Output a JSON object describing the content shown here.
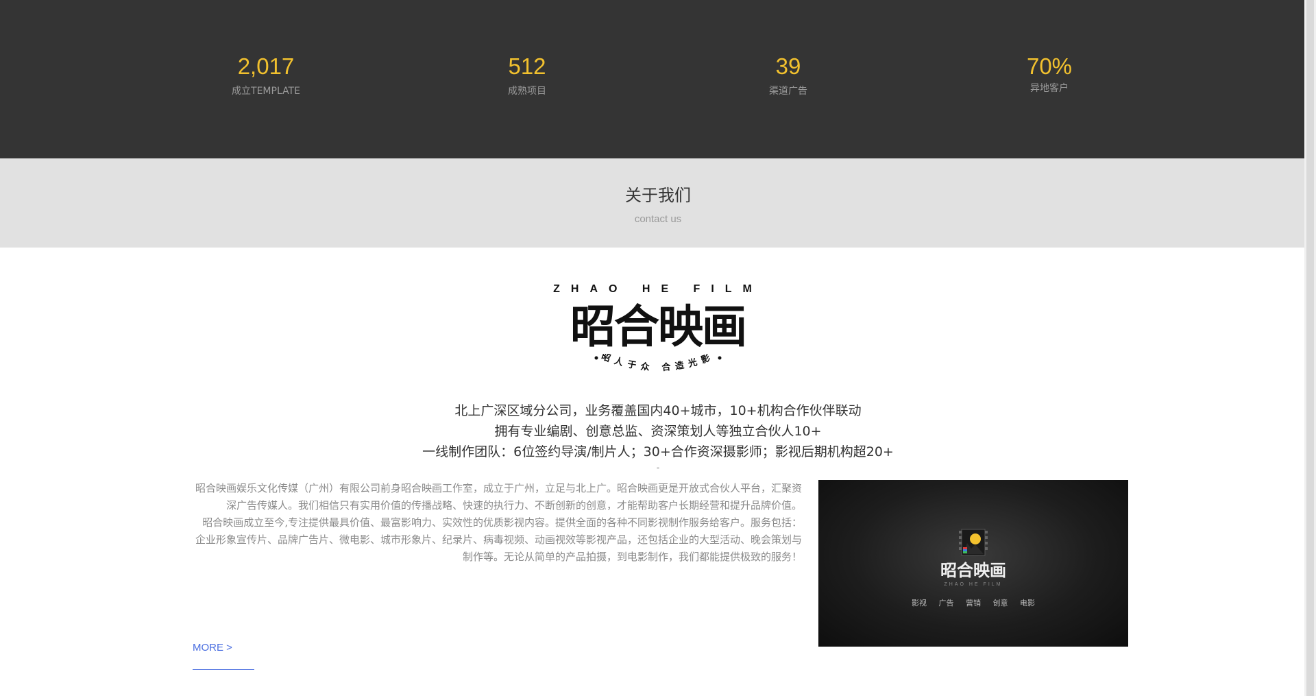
{
  "stats": [
    {
      "value": "2,017",
      "label": "成立TEMPLATE"
    },
    {
      "value": "512",
      "label": "成熟项目"
    },
    {
      "value": "39",
      "label": "渠道广告"
    },
    {
      "value": "70%",
      "label": "异地客户"
    }
  ],
  "about": {
    "title": "关于我们",
    "subtitle": "contact us"
  },
  "logo": {
    "english": "ZHAO HE FILM",
    "chinese": "昭合映画",
    "slogan": "昭人于众 合造光影"
  },
  "highlights": [
    "北上广深区域分公司，业务覆盖国内40+城市，10+机构合作伙伴联动",
    "拥有专业编剧、创意总监、资深策划人等独立合伙人10+",
    "一线制作团队：6位签约导演/制片人；30+合作资深摄影师；影视后期机构超20+",
    "-"
  ],
  "description": {
    "paragraph1": "昭合映画娱乐文化传媒（广州）有限公司前身昭合映画工作室，成立于广州，立足与北上广。昭合映画更是开放式合伙人平台，汇聚资深广告传媒人。我们相信只有实用价值的传播战略、快速的执行力、不断创新的创意，才能帮助客户长期经营和提升品牌价值。",
    "paragraph2": "昭合映画成立至今,专注提供最具价值、最富影响力、实效性的优质影视内容。提供全面的各种不同影视制作服务给客户。服务包括：企业形象宣传片、品牌广告片、微电影、城市形象片、纪录片、病毒视频、动画视效等影视产品，还包括企业的大型活动、晚会策划与制作等。无论从简单的产品拍摄，到电影制作，我们都能提供极致的服务！"
  },
  "video": {
    "logo_text": "昭合映画",
    "logo_sub": "ZHAO HE FILM",
    "tags": [
      "影视",
      "广告",
      "营销",
      "创意",
      "电影"
    ]
  },
  "more_link": {
    "label": "MORE >"
  },
  "colors": {
    "stats_bg": "#343434",
    "stat_value": "#f2c12e",
    "about_bg": "#e1e1e1",
    "link": "#4a6ee0"
  }
}
